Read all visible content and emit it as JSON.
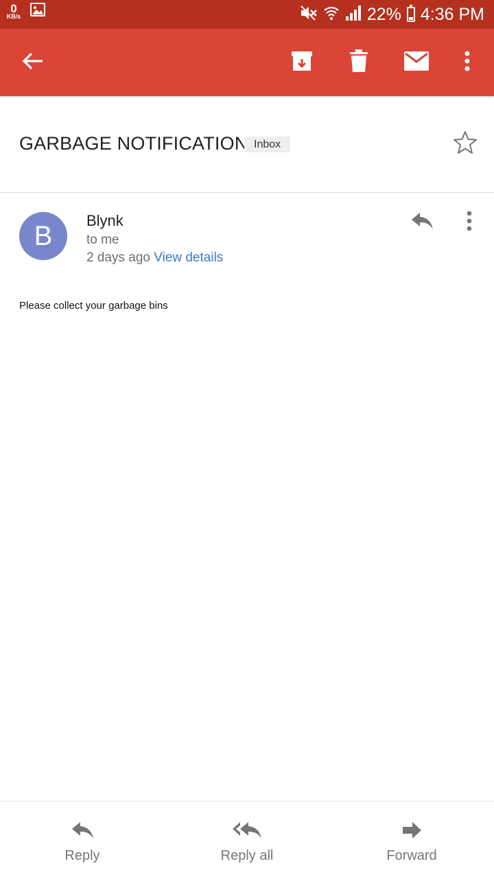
{
  "status_bar": {
    "speed_value": "0",
    "speed_unit": "KB/s",
    "battery": "22%",
    "battery_level": 0.22,
    "time": "4:36 PM"
  },
  "app_bar": {
    "color": "#db4437",
    "icons": [
      "back-arrow-icon",
      "archive-icon",
      "delete-icon",
      "mark-unread-icon",
      "more-vert-icon"
    ]
  },
  "email": {
    "subject": "GARBAGE NOTIFICATION",
    "label": "Inbox",
    "sender_initial": "B",
    "sender": "Blynk",
    "recipient": "to me",
    "time_ago": "2 days ago",
    "view_details": "View details",
    "body": "Please collect your garbage bins",
    "avatar_color": "#7986cb"
  },
  "bottom_actions": {
    "reply": "Reply",
    "reply_all": "Reply all",
    "forward": "Forward"
  }
}
